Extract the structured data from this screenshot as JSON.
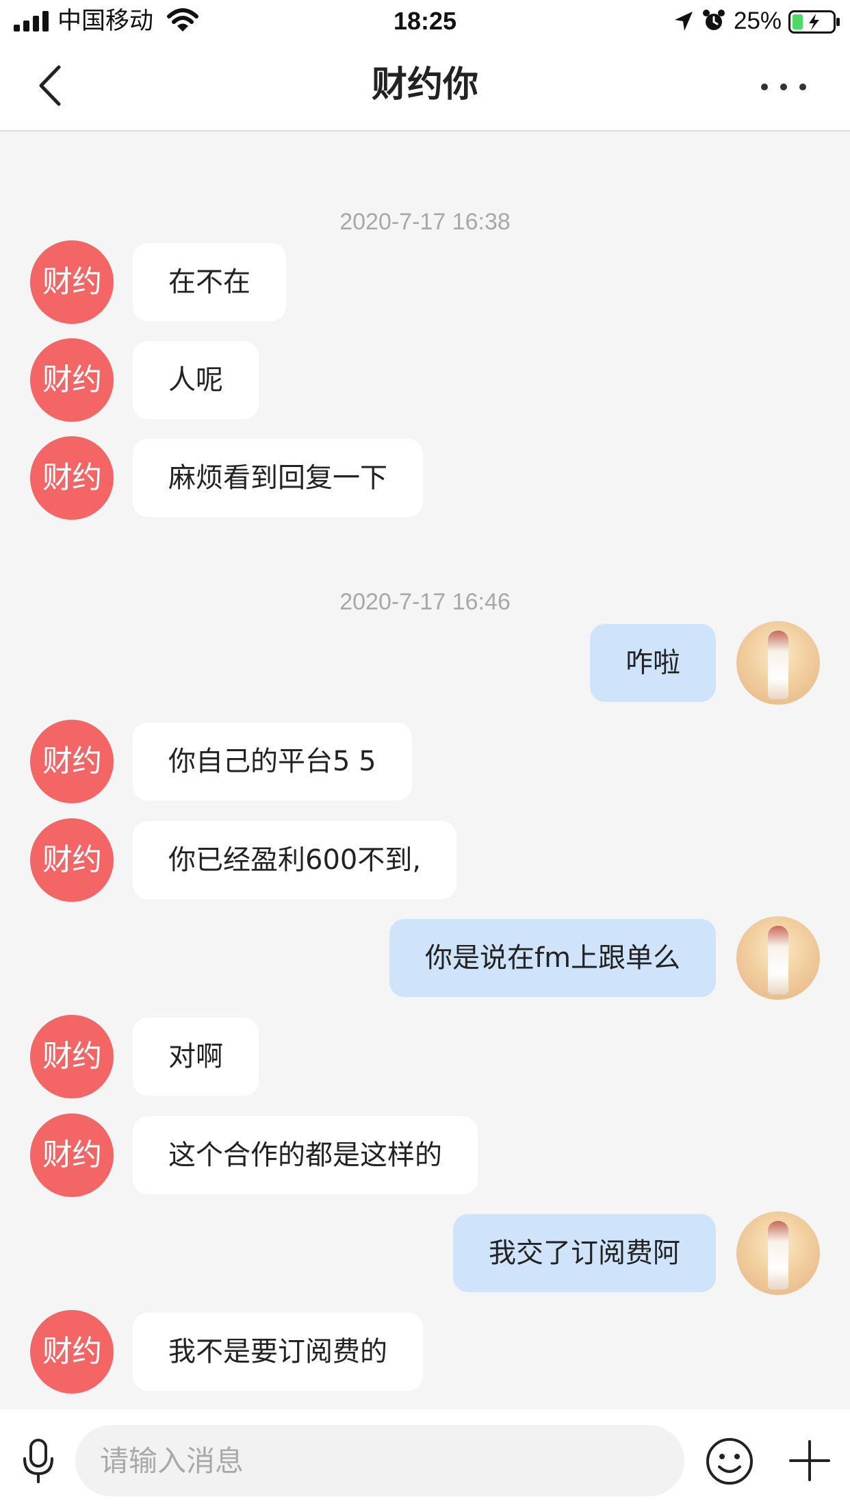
{
  "status_bar": {
    "carrier": "中国移动",
    "time": "18:25",
    "battery_percent": "25%",
    "battery_level": 0.25,
    "icons": [
      "signal-icon",
      "wifi-icon",
      "location-icon",
      "alarm-icon",
      "battery-icon"
    ]
  },
  "nav": {
    "title": "财约你",
    "back_icon": "chevron-left-icon",
    "more_icon": "more-icon"
  },
  "contact_avatar_text": "财约",
  "messages": [
    {
      "type": "message",
      "side": "left",
      "text": "人呢"
    },
    {
      "type": "timestamp",
      "text": "2020-7-17 16:38"
    },
    {
      "type": "message",
      "side": "left",
      "text": "在不在"
    },
    {
      "type": "message",
      "side": "left",
      "text": "人呢"
    },
    {
      "type": "message",
      "side": "left",
      "text": "麻烦看到回复一下"
    },
    {
      "type": "timestamp",
      "text": "2020-7-17 16:46"
    },
    {
      "type": "message",
      "side": "right",
      "text": "咋啦"
    },
    {
      "type": "message",
      "side": "left",
      "text": "你自己的平台5  5"
    },
    {
      "type": "message",
      "side": "left",
      "text": "你已经盈利600不到,"
    },
    {
      "type": "message",
      "side": "right",
      "text": "你是说在fm上跟单么"
    },
    {
      "type": "message",
      "side": "left",
      "text": "对啊"
    },
    {
      "type": "message",
      "side": "left",
      "text": "这个合作的都是这样的"
    },
    {
      "type": "message",
      "side": "right",
      "text": "我交了订阅费阿"
    },
    {
      "type": "message",
      "side": "left",
      "text": "我不是要订阅费的"
    }
  ],
  "input_bar": {
    "placeholder": "请输入消息",
    "value": "",
    "icons": [
      "microphone-icon",
      "emoji-icon",
      "plus-icon"
    ]
  },
  "colors": {
    "chat_background": "#f5f5f5",
    "contact_avatar": "#f46565",
    "incoming_bubble": "#ffffff",
    "outgoing_bubble": "#cfe4fb",
    "timestamp_text": "#a8a8a8",
    "battery_fill": "#4cd964"
  }
}
